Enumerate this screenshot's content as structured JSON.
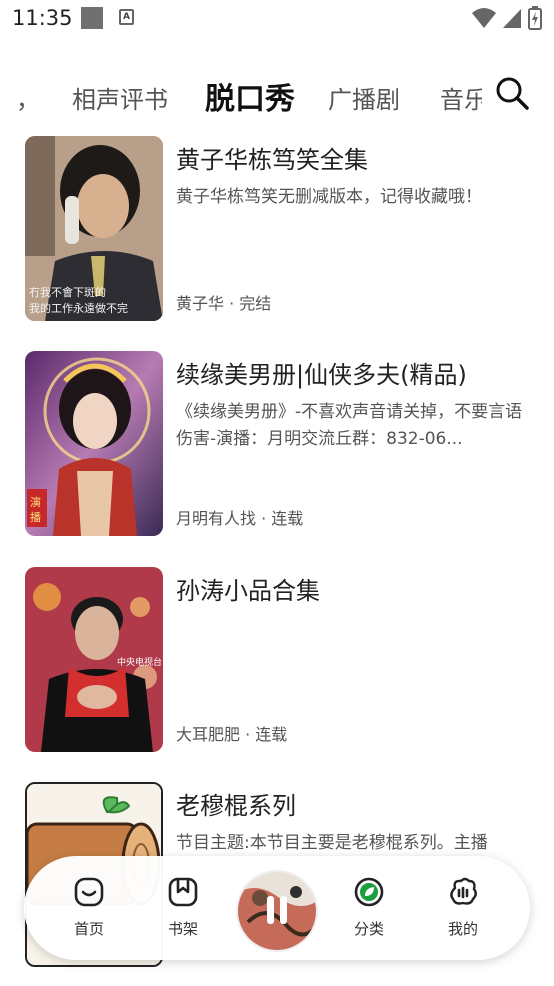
{
  "status_bar": {
    "time": "11:35"
  },
  "tabs": [
    {
      "label": "，",
      "active": false
    },
    {
      "label": "相声评书",
      "active": false
    },
    {
      "label": "脱口秀",
      "active": true
    },
    {
      "label": "广播剧",
      "active": false
    },
    {
      "label": "音乐",
      "active": false
    }
  ],
  "items": [
    {
      "title": "黄子华栋笃笑全集",
      "desc": "黄子华栋笃笑无删减版本，记得收藏哦！",
      "meta": "黄子华 · 完结",
      "cover_text": "冇我不會下斑的\n我的工作永遠做不完"
    },
    {
      "title": "续缘美男册|仙侠多夫(精品)",
      "desc": "《续缘美男册》-不喜欢声音请关掉，不要言语伤害-演播：月明交流丘群：832-06...",
      "meta": "月明有人找 · 连载",
      "cover_text": "演播"
    },
    {
      "title": "孙涛小品合集",
      "desc": "",
      "meta": "大耳肥肥 · 连载",
      "cover_text": "中央电视台"
    },
    {
      "title": "老穆棍系列",
      "desc": "节目主题:本节目主要是老穆棍系列。主播",
      "meta": "",
      "cover_text": ""
    }
  ],
  "nav": [
    {
      "label": "首页",
      "icon": "home-icon"
    },
    {
      "label": "书架",
      "icon": "bookshelf-icon"
    },
    {
      "label": "分类",
      "icon": "category-icon"
    },
    {
      "label": "我的",
      "icon": "profile-icon"
    }
  ],
  "colors": {
    "accent": "#2E7D32",
    "nav_category": "#1B9E3E"
  }
}
